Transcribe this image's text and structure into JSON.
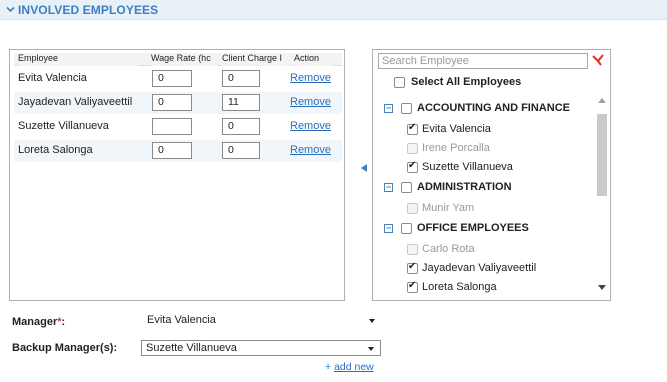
{
  "section": {
    "title": "INVOLVED EMPLOYEES"
  },
  "table": {
    "headers": [
      "Employee",
      "Wage Rate (hc",
      "Client Charge I",
      "Action"
    ],
    "rows": [
      {
        "name": "Evita Valencia",
        "wage": "0",
        "charge": "0",
        "action": "Remove"
      },
      {
        "name": "Jayadevan Valiyaveettil",
        "wage": "0",
        "charge": "11",
        "action": "Remove"
      },
      {
        "name": "Suzette Villanueva",
        "wage": "",
        "charge": "0",
        "action": "Remove"
      },
      {
        "name": "Loreta Salonga",
        "wage": "0",
        "charge": "0",
        "action": "Remove"
      }
    ]
  },
  "picker": {
    "search_placeholder": "Search Employee",
    "select_all": "Select All Employees",
    "groups": [
      {
        "label": "ACCOUNTING AND FINANCE",
        "items": [
          {
            "label": "Evita Valencia",
            "checked": true,
            "disabled": false
          },
          {
            "label": "Irene Porcalla",
            "checked": false,
            "disabled": true
          },
          {
            "label": "Suzette Villanueva",
            "checked": true,
            "disabled": false
          }
        ]
      },
      {
        "label": "ADMINISTRATION",
        "items": [
          {
            "label": "Munir Yam",
            "checked": false,
            "disabled": true
          }
        ]
      },
      {
        "label": "OFFICE EMPLOYEES",
        "items": [
          {
            "label": "Carlo Rota",
            "checked": false,
            "disabled": true
          },
          {
            "label": "Jayadevan Valiyaveettil",
            "checked": true,
            "disabled": false
          },
          {
            "label": "Loreta Salonga",
            "checked": true,
            "disabled": false
          }
        ]
      }
    ]
  },
  "form": {
    "manager_label": "Manager",
    "required_mark": "*",
    "manager_colon": ":",
    "manager_value": "Evita Valencia",
    "backup_label": "Backup Manager(s):",
    "backup_value": "Suzette Villanueva",
    "add_new_plus": "+",
    "add_new": "add new"
  },
  "colors": {
    "accent": "#3e7fc0",
    "link": "#2a6ebb",
    "required": "#e03030",
    "clear": "#e0302a"
  }
}
